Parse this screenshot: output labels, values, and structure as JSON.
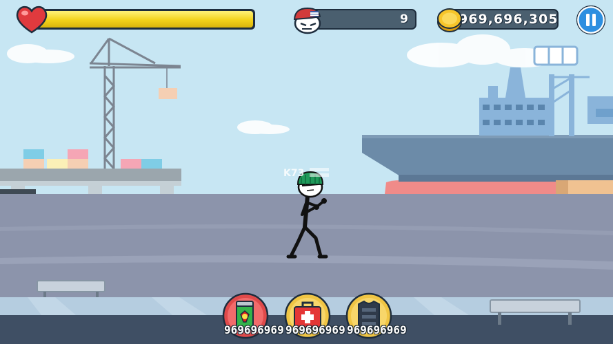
{
  "hud": {
    "health": {
      "level": 1.0,
      "icon": "heart-icon"
    },
    "kills": {
      "value": "9",
      "icon": "enemy-head-icon"
    },
    "coins": {
      "value": "969,696,305",
      "icon": "coin-icon"
    },
    "pause": {
      "icon": "pause-icon"
    }
  },
  "items": [
    {
      "name": "energy-drink",
      "icon": "energy-drink-icon",
      "count": "969696969"
    },
    {
      "name": "medkit",
      "icon": "medkit-icon",
      "count": "969696969"
    },
    {
      "name": "armor-vest",
      "icon": "armor-vest-icon",
      "count": "969696969"
    }
  ],
  "watermark": "K73",
  "colors": {
    "sky": "#c7e6f3",
    "ground": "#8c94ab",
    "ship": "#6c8ba8",
    "hp_bar": "#f3d21a",
    "hud_frame": "#1e2d3d",
    "hat": "#1f9a5a"
  }
}
